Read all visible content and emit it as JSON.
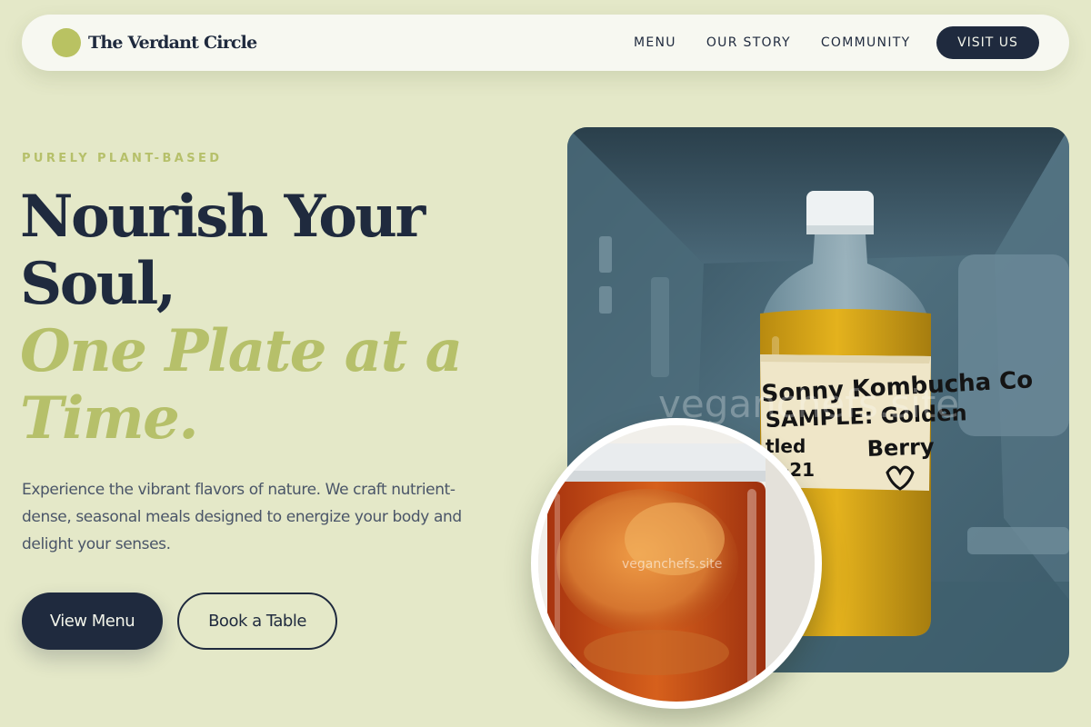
{
  "header": {
    "brand_name": "The Verdant Circle",
    "nav": [
      "MENU",
      "OUR STORY",
      "COMMUNITY"
    ],
    "cta_label": "VISIT US"
  },
  "hero": {
    "eyebrow": "PURELY PLANT-BASED",
    "headline_line1": "Nourish Your",
    "headline_line2": "Soul,",
    "headline_accent_line1": "One Plate at a",
    "headline_accent_line2": "Time.",
    "description": "Experience the vibrant flavors of nature. We craft nutrient-dense, seasonal meals designed to energize your body and delight your senses.",
    "primary_button": "View Menu",
    "secondary_button": "Book a Table"
  },
  "images": {
    "main": {
      "label_lines": [
        "Sonny Kombucha Co",
        "SAMPLE: Golden",
        "Berry"
      ],
      "label_side": [
        "tled",
        "1-21"
      ],
      "watermark": "veganchefs.site"
    },
    "inset": {
      "watermark": "veganchefs.site"
    }
  },
  "colors": {
    "background": "#e4e8c8",
    "navy": "#1f2a3e",
    "accent_green": "#b6c06a",
    "nav_background": "#f7f8f1"
  },
  "icons": {
    "logo": "circle-logo-icon"
  }
}
